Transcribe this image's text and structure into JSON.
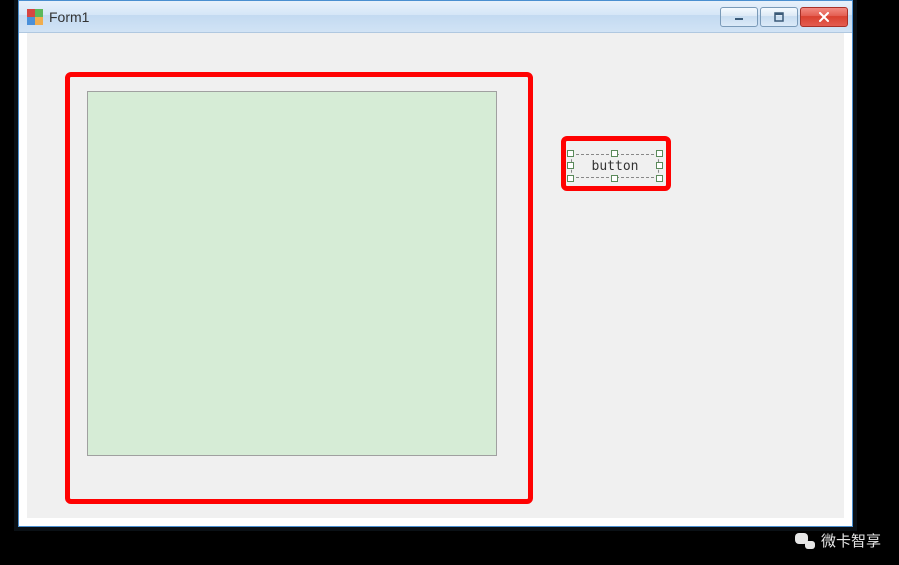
{
  "window": {
    "title": "Form1"
  },
  "designer": {
    "button_label": "button"
  },
  "watermark": {
    "text": "微卡智享"
  }
}
